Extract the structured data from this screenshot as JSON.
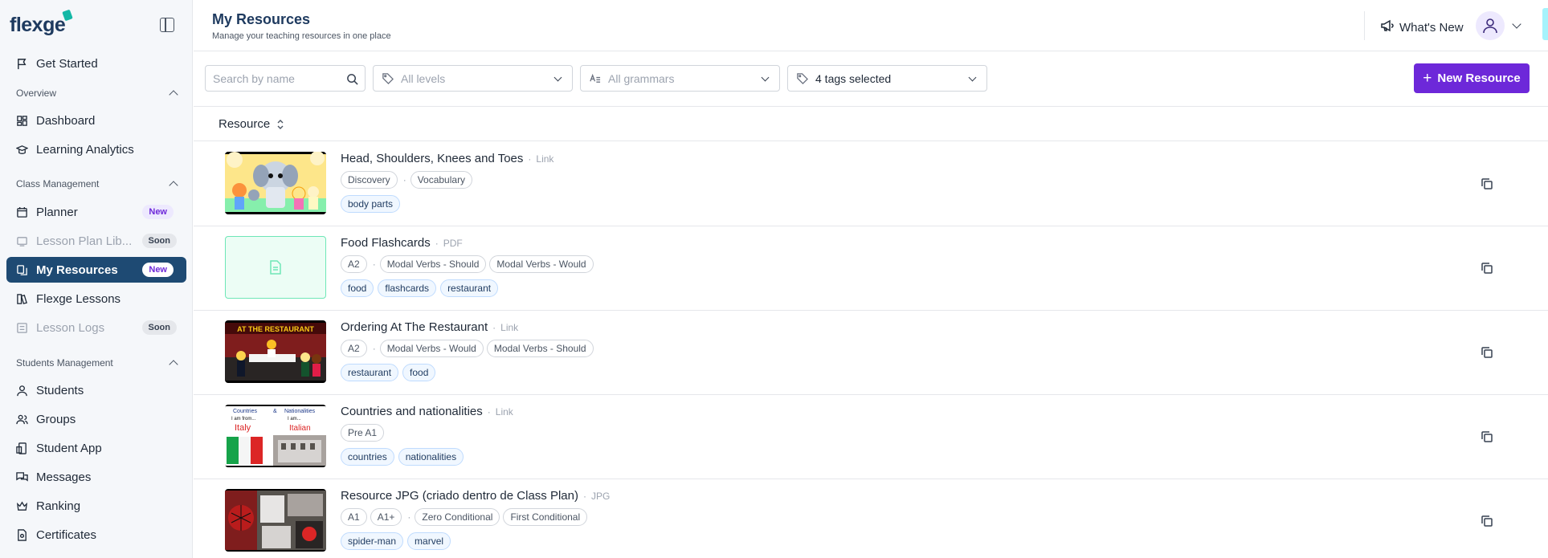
{
  "brand": {
    "name": "flexge"
  },
  "sidebar": {
    "get_started": "Get Started",
    "sections": [
      {
        "title": "Overview"
      },
      {
        "title": "Class Management"
      },
      {
        "title": "Students Management"
      }
    ],
    "items": [
      {
        "label": "Dashboard",
        "icon": "dashboard-icon"
      },
      {
        "label": "Learning Analytics",
        "icon": "graduation-cap-icon"
      },
      {
        "label": "Planner",
        "icon": "calendar-icon",
        "badge": "New"
      },
      {
        "label": "Lesson Plan Lib...",
        "icon": "tablet-icon",
        "badge": "Soon"
      },
      {
        "label": "My Resources",
        "icon": "resources-icon",
        "badge": "New"
      },
      {
        "label": "Flexge Lessons",
        "icon": "book-icon"
      },
      {
        "label": "Lesson Logs",
        "icon": "list-icon",
        "badge": "Soon"
      },
      {
        "label": "Students",
        "icon": "user-icon"
      },
      {
        "label": "Groups",
        "icon": "users-icon"
      },
      {
        "label": "Student App",
        "icon": "app-icon"
      },
      {
        "label": "Messages",
        "icon": "messages-icon"
      },
      {
        "label": "Ranking",
        "icon": "crown-icon"
      },
      {
        "label": "Certificates",
        "icon": "certificate-icon"
      }
    ]
  },
  "header": {
    "title": "My Resources",
    "subtitle": "Manage your teaching resources in one place",
    "whats_new": "What's New"
  },
  "toolbar": {
    "search_placeholder": "Search by name",
    "levels": "All levels",
    "grammars": "All grammars",
    "tags": "4 tags selected",
    "new_resource": "New Resource"
  },
  "table": {
    "column": "Resource",
    "rows": [
      {
        "title": "Head, Shoulders, Knees and Toes",
        "type": "Link",
        "meta": [
          "Discovery",
          "Vocabulary"
        ],
        "tags": [
          "body parts"
        ]
      },
      {
        "title": "Food Flashcards",
        "type": "PDF",
        "meta": [
          "A2",
          "Modal Verbs - Should",
          "Modal Verbs - Would"
        ],
        "tags": [
          "food",
          "flashcards",
          "restaurant"
        ]
      },
      {
        "title": "Ordering At The Restaurant",
        "type": "Link",
        "meta": [
          "A2",
          "Modal Verbs - Would",
          "Modal Verbs - Should"
        ],
        "tags": [
          "restaurant",
          "food"
        ],
        "thumb_caption": "AT THE RESTAURANT"
      },
      {
        "title": "Countries and nationalities",
        "type": "Link",
        "meta": [
          "Pre A1"
        ],
        "tags": [
          "countries",
          "nationalities"
        ],
        "thumb_text": [
          "Countries",
          "&",
          "Nationalities",
          "I am from...",
          "I am...",
          "Italy",
          "Italian"
        ]
      },
      {
        "title": "Resource JPG (criado dentro de Class Plan)",
        "type": "JPG",
        "meta": [
          "A1",
          "A1+",
          "Zero Conditional",
          "First Conditional"
        ],
        "tags": [
          "spider-man",
          "marvel"
        ]
      }
    ]
  },
  "colors": {
    "brand": "#1e3a5f",
    "active": "#1e4a73",
    "primary": "#6d28d9"
  }
}
